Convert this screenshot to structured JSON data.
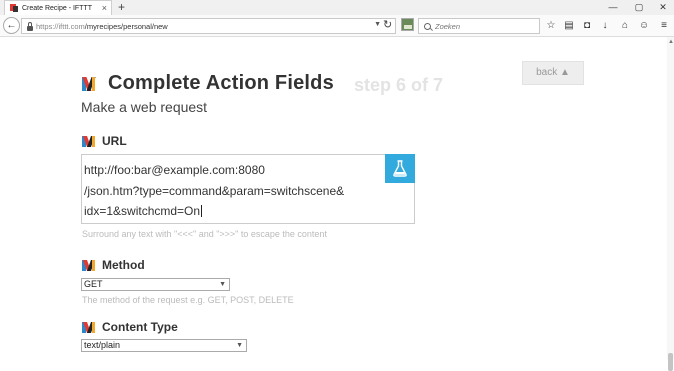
{
  "browser": {
    "tab_title": "Create Recipe - IFTTT",
    "tab_close": "×",
    "new_tab": "+",
    "window_controls": [
      "—",
      "▢",
      "✕"
    ],
    "url_host": "https://ifttt.com",
    "url_path": "/myrecipes/personal/new",
    "search_placeholder": "Zoeken",
    "toolbar_icons": [
      "star-icon",
      "reading-list-icon",
      "pocket-icon",
      "download-icon",
      "home-icon",
      "chat-icon",
      "menu-icon"
    ]
  },
  "page": {
    "title": "Complete Action Fields",
    "step": "step 6 of 7",
    "back_label": "back ▲",
    "subtitle": "Make a web request",
    "url_field": {
      "label": "URL",
      "lines": [
        "http://foo:bar@example.com:8080",
        "/json.htm?type=command&param=switchscene&",
        "idx=1&switchcmd=On"
      ],
      "hint": "Surround any text with \"<<<\" and \">>>\" to escape the content"
    },
    "method_field": {
      "label": "Method",
      "selected": "GET",
      "hint": "The method of the request e.g. GET, POST, DELETE"
    },
    "content_type_field": {
      "label": "Content Type",
      "selected": "text/plain"
    }
  },
  "colors": {
    "flask_button": "#33aadd",
    "step_text": "#e3e3e3",
    "hint_text": "#bbbbbb"
  }
}
